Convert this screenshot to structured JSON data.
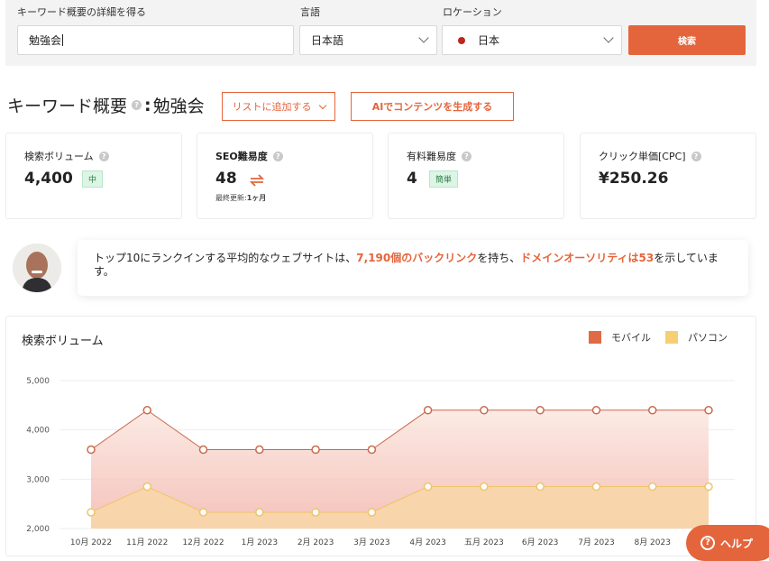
{
  "search": {
    "keyword_label": "キーワード概要の詳細を得る",
    "keyword_value": "勉強会",
    "language_label": "言語",
    "language_value": "日本語",
    "location_label": "ロケーション",
    "location_value": "日本",
    "search_button": "検索"
  },
  "overview": {
    "title": "キーワード概要",
    "separator": ":",
    "keyword": "勉強会",
    "add_to_list": "リストに追加する",
    "ai_generate": "AIでコンテンツを生成する"
  },
  "metrics": {
    "volume": {
      "label": "検索ボリューム",
      "value": "4,400",
      "badge": "中"
    },
    "seo": {
      "label": "SEO難易度",
      "value": "48",
      "updated_label": "最終更新:",
      "updated_value": "1ヶ月"
    },
    "paid": {
      "label": "有料難易度",
      "value": "4",
      "badge": "簡単"
    },
    "cpc": {
      "label": "クリック単価[CPC]",
      "value": "¥250.26"
    }
  },
  "tip": {
    "part1": "トップ10にランクインする平均的なウェブサイトは、",
    "backlinks": "7,190個のバックリンク",
    "part2": "を持ち、",
    "authority": "ドメインオーソリティは53",
    "part3": "を示しています。"
  },
  "colors": {
    "accent": "#e4653c",
    "mobile": "#e06a45",
    "desktop": "#f6cf72",
    "badge_bg": "#dcf5e4"
  },
  "chart_data": {
    "type": "area",
    "title": "検索ボリューム",
    "legend_position": "top-right",
    "categories": [
      "10月 2022",
      "11月 2022",
      "12月 2022",
      "1月 2023",
      "2月 2023",
      "3月 2023",
      "4月 2023",
      "五月 2023",
      "6月 2023",
      "7月 2023",
      "8月 2023",
      ""
    ],
    "y_ticks": [
      "5,000",
      "4,000",
      "3,000",
      "2,000"
    ],
    "ylim": [
      2000,
      5000
    ],
    "grid": true,
    "series": [
      {
        "name": "モバイル",
        "values": [
          3600,
          4400,
          3600,
          3600,
          3600,
          3600,
          4400,
          4400,
          4400,
          4400,
          4400,
          4400
        ]
      },
      {
        "name": "パソコン",
        "values": [
          2330,
          2850,
          2330,
          2330,
          2330,
          2330,
          2850,
          2850,
          2850,
          2850,
          2850,
          2850
        ]
      }
    ]
  },
  "help": {
    "label": "ヘルプ"
  }
}
